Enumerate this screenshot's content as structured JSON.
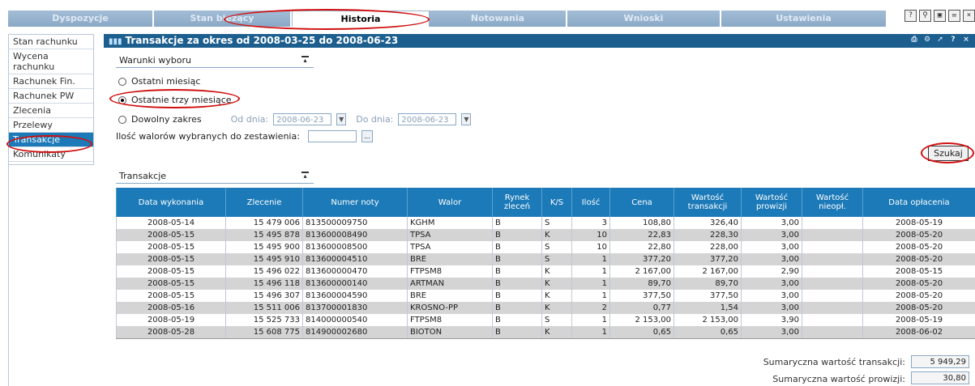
{
  "tabs": [
    "Dyspozycje",
    "Stan bieżący",
    "Historia",
    "Notowania",
    "Wnioski",
    "Ustawienia"
  ],
  "active_tab": "Historia",
  "top_icons": [
    "help-icon",
    "search-icon",
    "lock-icon",
    "mail-icon",
    "close-icon"
  ],
  "sidebar": {
    "items": [
      "Stan rachunku",
      "Wycena rachunku",
      "Rachunek Fin.",
      "Rachunek PW",
      "Zlecenia",
      "Przelewy",
      "Transakcje",
      "Komunikaty"
    ],
    "active": "Transakcje"
  },
  "title": "Transakcje za okres od 2008-03-25 do 2008-06-23",
  "criteria": {
    "header": "Warunki wyboru",
    "option_last_month": "Ostatni miesiąc",
    "option_last_three": "Ostatnie trzy miesiące",
    "option_range": "Dowolny zakres",
    "from_label": "Od dnia:",
    "from_value": "2008-06-23",
    "to_label": "Do dnia:",
    "to_value": "2008-06-23",
    "count_label": "Ilość walorów wybranych do zestawienia:",
    "count_value": "",
    "selected": "Ostatnie trzy miesiące"
  },
  "search_button": "Szukaj",
  "table": {
    "header": "Transakcje",
    "columns": [
      "Data wykonania",
      "Zlecenie",
      "Numer noty",
      "Walor",
      "Rynek zleceń",
      "K/S",
      "Ilość",
      "Cena",
      "Wartość transakcji",
      "Wartość prowizji",
      "Wartość nieopł.",
      "Data opłacenia"
    ],
    "rows": [
      [
        "2008-05-14",
        "15 479 006",
        "813500009750",
        "KGHM",
        "B",
        "S",
        "3",
        "108,80",
        "326,40",
        "3,00",
        "",
        "2008-05-19"
      ],
      [
        "2008-05-15",
        "15 495 878",
        "813600008490",
        "TPSA",
        "B",
        "K",
        "10",
        "22,83",
        "228,30",
        "3,00",
        "",
        "2008-05-20"
      ],
      [
        "2008-05-15",
        "15 495 900",
        "813600008500",
        "TPSA",
        "B",
        "S",
        "10",
        "22,80",
        "228,00",
        "3,00",
        "",
        "2008-05-20"
      ],
      [
        "2008-05-15",
        "15 495 910",
        "813600004510",
        "BRE",
        "B",
        "S",
        "1",
        "377,20",
        "377,20",
        "3,00",
        "",
        "2008-05-20"
      ],
      [
        "2008-05-15",
        "15 496 022",
        "813600000470",
        "FTPSM8",
        "B",
        "K",
        "1",
        "2 167,00",
        "2 167,00",
        "2,90",
        "",
        "2008-05-15"
      ],
      [
        "2008-05-15",
        "15 496 118",
        "813600000140",
        "ARTMAN",
        "B",
        "K",
        "1",
        "89,70",
        "89,70",
        "3,00",
        "",
        "2008-05-20"
      ],
      [
        "2008-05-15",
        "15 496 307",
        "813600004590",
        "BRE",
        "B",
        "K",
        "1",
        "377,50",
        "377,50",
        "3,00",
        "",
        "2008-05-20"
      ],
      [
        "2008-05-16",
        "15 511 006",
        "813700001830",
        "KROSNO-PP",
        "B",
        "K",
        "2",
        "0,77",
        "1,54",
        "3,00",
        "",
        "2008-05-20"
      ],
      [
        "2008-05-19",
        "15 525 733",
        "814000000540",
        "FTPSM8",
        "B",
        "S",
        "1",
        "2 153,00",
        "2 153,00",
        "3,90",
        "",
        "2008-05-19"
      ],
      [
        "2008-05-28",
        "15 608 775",
        "814900002680",
        "BIOTON",
        "B",
        "K",
        "1",
        "0,65",
        "0,65",
        "3,00",
        "",
        "2008-06-02"
      ]
    ]
  },
  "summary": {
    "total_transactions_label": "Sumaryczna wartość transakcji:",
    "total_transactions_value": "5 949,29",
    "total_commission_label": "Sumaryczna wartość prowizji:",
    "total_commission_value": "30,80"
  }
}
